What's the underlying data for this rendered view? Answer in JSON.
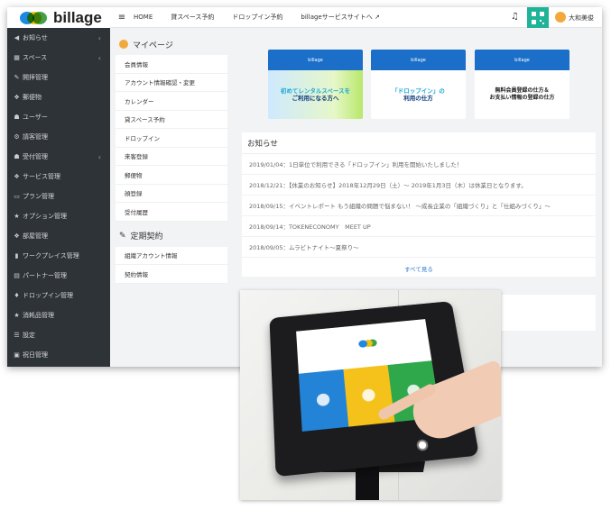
{
  "brand": {
    "name": "billage"
  },
  "sidebar": {
    "items": [
      {
        "icon": "bullhorn-icon",
        "glyph": "◀",
        "label": "お知らせ",
        "chevron": true
      },
      {
        "icon": "grid-icon",
        "glyph": "▦",
        "label": "スペース",
        "chevron": true
      },
      {
        "icon": "wrench-icon",
        "glyph": "✎",
        "label": "開拝管理",
        "chevron": false
      },
      {
        "icon": "cubes-icon",
        "glyph": "❖",
        "label": "郵便物",
        "chevron": false
      },
      {
        "icon": "users-icon",
        "glyph": "☗",
        "label": "ユーザー",
        "chevron": false
      },
      {
        "icon": "cogs-icon",
        "glyph": "⚙",
        "label": "請客管理",
        "chevron": false
      },
      {
        "icon": "reception-icon",
        "glyph": "☗",
        "label": "受付管理",
        "chevron": true
      },
      {
        "icon": "services-icon",
        "glyph": "❖",
        "label": "サービス管理",
        "chevron": false
      },
      {
        "icon": "folder-icon",
        "glyph": "▭",
        "label": "プラン管理",
        "chevron": false
      },
      {
        "icon": "star-icon",
        "glyph": "★",
        "label": "オプション管理",
        "chevron": false
      },
      {
        "icon": "rooms-icon",
        "glyph": "❖",
        "label": "部屋管理",
        "chevron": false
      },
      {
        "icon": "building-icon",
        "glyph": "▮",
        "label": "ワークプレイス管理",
        "chevron": false
      },
      {
        "icon": "table-icon",
        "glyph": "▤",
        "label": "パートナー管理",
        "chevron": false
      },
      {
        "icon": "fire-icon",
        "glyph": "♦",
        "label": "ドロップイン管理",
        "chevron": false
      },
      {
        "icon": "star-icon",
        "glyph": "★",
        "label": "消耗品管理",
        "chevron": false
      },
      {
        "icon": "list-icon",
        "glyph": "☰",
        "label": "設定",
        "chevron": false
      },
      {
        "icon": "calendar-icon",
        "glyph": "▣",
        "label": "祝日管理",
        "chevron": false
      }
    ]
  },
  "topbar": {
    "menu_glyph": "≡",
    "nav": [
      "HOME",
      "貸スペース予約",
      "ドロップイン予約",
      "billageサービスサイトへ ↗"
    ],
    "bell_glyph": "♫",
    "user_name": "大和美俊"
  },
  "mypage": {
    "title": "マイページ",
    "items": [
      "会員情報",
      "アカウント情報確認・変更",
      "カレンダー",
      "貸スペース予約",
      "ドロップイン",
      "来客登録",
      "郵便物",
      "顔登録",
      "受付履歴"
    ]
  },
  "contract": {
    "title": "定期契約",
    "pen_glyph": "✎",
    "items": [
      "組織アカウント情報",
      "契約情報"
    ]
  },
  "banners": [
    {
      "head": "billage",
      "line1": "初めてレンタルスペースを",
      "line2": "ご利用になる方へ"
    },
    {
      "head": "billage",
      "line1": "「ドロップイン」の",
      "line2": "利用の仕方"
    },
    {
      "head": "billage",
      "line1": "無料会員登録の仕方＆",
      "line2": "お支払い情報の登録の仕方"
    }
  ],
  "news": {
    "title": "お知らせ",
    "items": [
      "2019/01/04：1日単位で利用できる「ドロップイン」利用を開始いたしました！",
      "2018/12/21：【休業のお知らせ】2018年12月29日（土）～ 2019年1月3日（木）は休業日となります。",
      "2018/09/15：イベントレポート もう組織の問題で悩まない！ ～成長企業の「組織づくり」と「仕組みづくり」～",
      "2018/09/14：TOKENECONOMY　MEET UP",
      "2018/09/05：ムラビトナイト～夏祭り～"
    ],
    "more_label": "すべて見る"
  },
  "kiosk": {
    "screen_logo": "billage"
  },
  "colors": {
    "sidebar_bg": "#2e3338",
    "qr_button": "#1fb398",
    "link": "#2d7ad1",
    "banner_head": "#1b6fc9"
  }
}
